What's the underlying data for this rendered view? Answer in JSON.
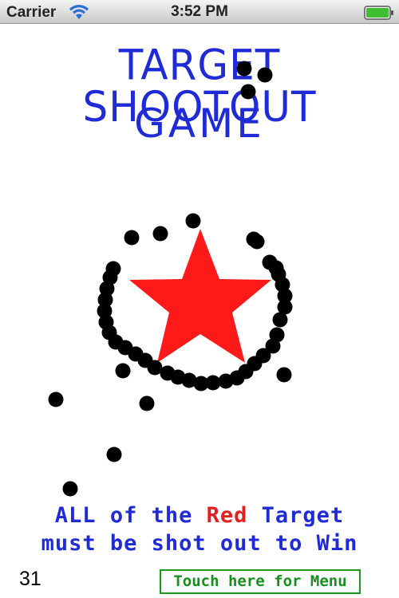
{
  "status_bar": {
    "carrier": "Carrier",
    "time": "3:52 PM",
    "icons": [
      "wifi-icon",
      "battery-icon"
    ]
  },
  "game": {
    "title_line1": "TARGET SHOOTOUT",
    "title_line2": "GAME",
    "title_color": "#1f2bd6",
    "target": {
      "shape": "star",
      "color": "#ff1a1a"
    },
    "bullet_hole_color": "#000000",
    "instruction_line1_before": "ALL of the ",
    "instruction_line1_red": "Red",
    "instruction_line1_after": " Target",
    "instruction_line2": "must be shot out to Win",
    "shot_count": "31",
    "menu_button_label": "Touch here for Menu",
    "menu_button_color": "#16901a"
  }
}
